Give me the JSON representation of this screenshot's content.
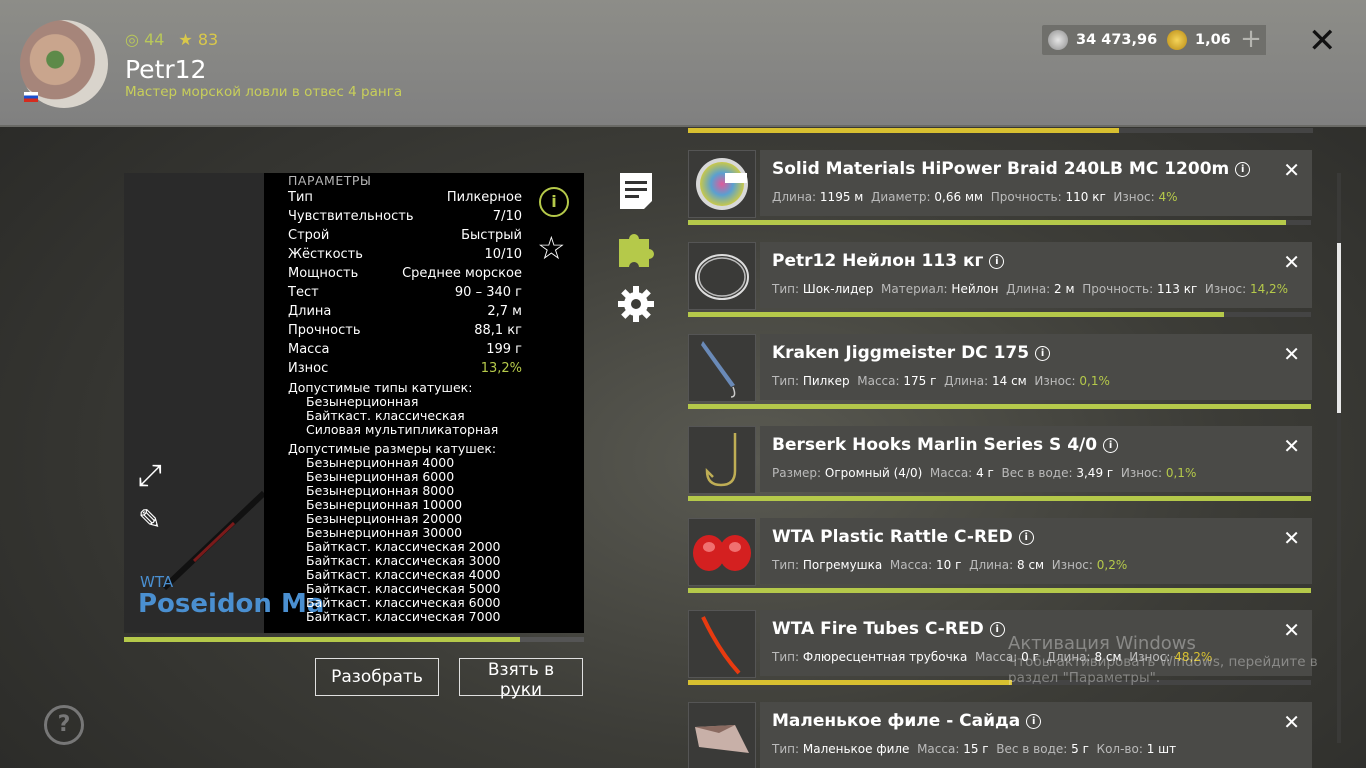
{
  "player": {
    "level": "44",
    "stars": "83",
    "name": "Petr12",
    "rank": "Мастер морской ловли в отвес 4 ранга"
  },
  "currency": {
    "silver": "34 473,96",
    "gold": "1,06"
  },
  "rod": {
    "brand": "WTA",
    "model": "Poseidon Ma",
    "params_title": "ПАРАМЕТРЫ",
    "params": [
      {
        "k": "Тип",
        "v": "Пилкерное"
      },
      {
        "k": "Чувствительность",
        "v": "7/10"
      },
      {
        "k": "Строй",
        "v": "Быстрый"
      },
      {
        "k": "Жёсткость",
        "v": "10/10"
      },
      {
        "k": "Мощность",
        "v": "Среднее морское"
      },
      {
        "k": "Тест",
        "v": "90 – 340 г"
      },
      {
        "k": "Длина",
        "v": "2,7 м"
      },
      {
        "k": "Прочность",
        "v": "88,1 кг"
      },
      {
        "k": "Масса",
        "v": "199 г"
      },
      {
        "k": "Износ",
        "v": "13,2%"
      }
    ],
    "reel_types_title": "Допустимые типы катушек:",
    "reel_types": [
      "Безынерционная",
      "Байткаст. классическая",
      "Силовая мультипликаторная"
    ],
    "reel_sizes_title": "Допустимые размеры катушек:",
    "reel_sizes": [
      "Безынерционная 4000",
      "Безынерционная 6000",
      "Безынерционная 8000",
      "Безынерционная 10000",
      "Безынерционная 20000",
      "Безынерционная 30000",
      "Байткаст. классическая 2000",
      "Байткаст. классическая 3000",
      "Байткаст. классическая 4000",
      "Байткаст. классическая 5000",
      "Байткаст. классическая 6000",
      "Байткаст. классическая 7000"
    ],
    "durability": 0.86,
    "btn_disassemble": "Разобрать",
    "btn_take": "Взять в руки"
  },
  "top_bar_fill": 0.69,
  "items": [
    {
      "name": "Solid Materials HiPower Braid 240LB MC 1200m",
      "details": [
        [
          "Длина:",
          "1195 м"
        ],
        [
          "Диаметр:",
          "0,66 мм"
        ],
        [
          "Прочность:",
          "110 кг"
        ],
        [
          "Износ:",
          "4%"
        ]
      ],
      "fill": 0.96,
      "color": "#b5c94a",
      "thumb": "spool"
    },
    {
      "name": "Petr12 Нейлон 113 кг",
      "details": [
        [
          "Тип:",
          "Шок-лидер"
        ],
        [
          "Материал:",
          "Нейлон"
        ],
        [
          "Длина:",
          "2 м"
        ],
        [
          "Прочность:",
          "113 кг"
        ],
        [
          "Износ:",
          "14,2%"
        ]
      ],
      "fill": 0.86,
      "color": "#b5c94a",
      "thumb": "coil"
    },
    {
      "name": "Kraken Jiggmeister DC 175",
      "details": [
        [
          "Тип:",
          "Пилкер"
        ],
        [
          "Масса:",
          "175 г"
        ],
        [
          "Длина:",
          "14 см"
        ],
        [
          "Износ:",
          "0,1%"
        ]
      ],
      "fill": 1.0,
      "color": "#b5c94a",
      "thumb": "jig"
    },
    {
      "name": "Berserk Hooks Marlin Series S 4/0",
      "details": [
        [
          "Размер:",
          "Огромный (4/0)"
        ],
        [
          "Масса:",
          "4 г"
        ],
        [
          "Вес в воде:",
          "3,49 г"
        ],
        [
          "Износ:",
          "0,1%"
        ]
      ],
      "fill": 1.0,
      "color": "#b5c94a",
      "thumb": "hook"
    },
    {
      "name": "WTA Plastic Rattle C-RED",
      "details": [
        [
          "Тип:",
          "Погремушка"
        ],
        [
          "Масса:",
          "10 г"
        ],
        [
          "Длина:",
          "8 см"
        ],
        [
          "Износ:",
          "0,2%"
        ]
      ],
      "fill": 1.0,
      "color": "#b5c94a",
      "thumb": "rattle"
    },
    {
      "name": "WTA Fire Tubes C-RED",
      "details": [
        [
          "Тип:",
          "Флюресцентная трубочка"
        ],
        [
          "Масса:",
          "0 г"
        ],
        [
          "Длина:",
          "8 см"
        ],
        [
          "Износ:",
          "48,2%"
        ]
      ],
      "fill": 0.52,
      "color": "#d8c030",
      "thumb": "tube"
    },
    {
      "name": "Маленькое филе - Сайда",
      "details": [
        [
          "Тип:",
          "Маленькое филе"
        ],
        [
          "Масса:",
          "15 г"
        ],
        [
          "Вес в воде:",
          "5 г"
        ],
        [
          "Кол-во:",
          "1 шт"
        ]
      ],
      "fill": 0,
      "color": "#b5c94a",
      "thumb": "fillet"
    }
  ],
  "watermark": {
    "line1": "Активация Windows",
    "line2": "Чтобы активировать Windows, перейдите в",
    "line3": "раздел \"Параметры\"."
  }
}
